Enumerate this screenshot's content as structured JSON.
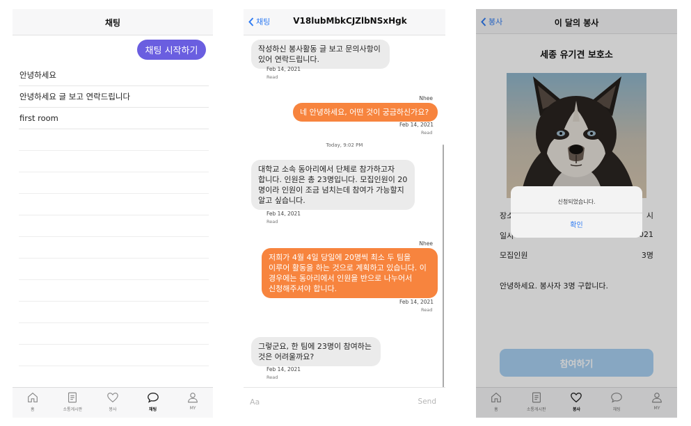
{
  "screen1": {
    "title": "채팅",
    "start_button": "채팅 시작하기",
    "rooms": [
      "안녕하세요",
      "안녕하세요 글 보고 연락드립니다",
      "first room"
    ],
    "accent": "#6a5ee0",
    "tabs": [
      {
        "label": "홈",
        "icon": "home-icon"
      },
      {
        "label": "소통게시판",
        "icon": "board-icon"
      },
      {
        "label": "봉사",
        "icon": "heart-icon"
      },
      {
        "label": "채팅",
        "icon": "chat-icon",
        "active": true
      },
      {
        "label": "MY",
        "icon": "person-icon"
      }
    ]
  },
  "screen2": {
    "back_label": "채팅",
    "title": "V18lubMbkCJZlbNSxHgk",
    "messages": [
      {
        "type": "incoming",
        "text_lines": [
          "작성하신 봉사활동 글 보고 문의사항이",
          "있어 연락드립니다."
        ],
        "date": "Feb 14, 2021",
        "status": "Read"
      },
      {
        "type": "outgoing",
        "sender": "Nhee",
        "text_lines": [
          "네 안녕하세요, 어떤 것이 궁금하신가요?"
        ],
        "date": "Feb 14, 2021",
        "status": "Read"
      },
      {
        "type": "incoming",
        "text_lines": [
          "대학교 소속 동아리에서 단체로 참가하고자",
          "합니다. 인원은 총 23명입니다. 모집인원이 20",
          "명이라 인원이 조금 넘치는데 참여가 가능할지",
          "알고 싶습니다."
        ],
        "date": "Feb 14, 2021",
        "status": "Read"
      },
      {
        "type": "outgoing",
        "sender": "Nhee",
        "text_lines": [
          "저희가 4월 4일 당일에 20명씩 최소 두 팀을",
          "이루어 활동을 하는 것으로 계획하고 있습니다. 이",
          "경우에는 동아리에서 인원을 반으로 나누어서",
          "신청해주셔야 합니다."
        ],
        "date": "Feb 14, 2021",
        "status": "Read"
      },
      {
        "type": "incoming",
        "text_lines": [
          "그렇군요, 한 팀에 23명이 참여하는",
          "것은 어려울까요?"
        ],
        "date": "Feb 14, 2021",
        "status": "Read"
      }
    ],
    "today_label": "Today, 9:02 PM",
    "input_placeholder": "Aa",
    "send_label": "Send",
    "outgoing_color": "#f7843e",
    "incoming_color": "#ebebeb"
  },
  "screen3": {
    "back_label": "봉사",
    "title": "이 달의 봉사",
    "detail_title": "세종 유기견 보호소",
    "rows": [
      {
        "label": "장소",
        "value": "시"
      },
      {
        "label": "일시",
        "value": "021"
      },
      {
        "label": "모집인원",
        "value": "3명"
      }
    ],
    "description": "안녕하세요. 봉사자 3명 구합니다.",
    "join_button": "참여하기",
    "alert": {
      "message": "신청되었습니다.",
      "confirm": "확인"
    },
    "tabs": [
      {
        "label": "홈",
        "icon": "home-icon"
      },
      {
        "label": "소통게시판",
        "icon": "board-icon"
      },
      {
        "label": "봉사",
        "icon": "heart-icon",
        "active": true
      },
      {
        "label": "채팅",
        "icon": "chat-icon"
      },
      {
        "label": "MY",
        "icon": "person-icon"
      }
    ]
  }
}
